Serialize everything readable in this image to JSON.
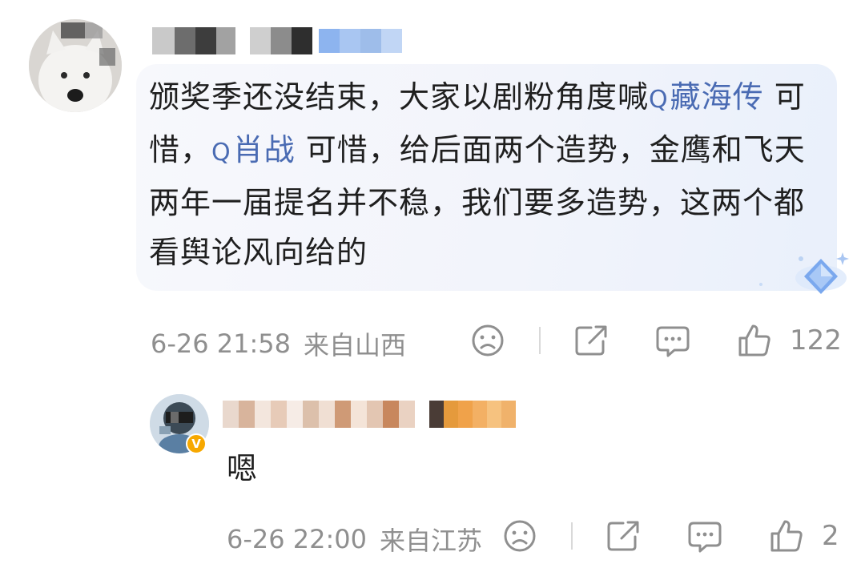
{
  "comment": {
    "text_segments": [
      {
        "kind": "text",
        "value": "颁奖季还没结束，大家以剧粉角度喊"
      },
      {
        "kind": "topic",
        "value": "藏海传"
      },
      {
        "kind": "text",
        "value": " 可惜，"
      },
      {
        "kind": "topic",
        "value": "肖战"
      },
      {
        "kind": "text",
        "value": " 可惜，给后面两个造势，金鹰和飞天两年一届提名并不稳，我们要多造势，这两个都看舆论风向给的"
      }
    ],
    "time": "6-26 21:58",
    "location": "来自山西",
    "like_count": "122",
    "icons": [
      "sad-face-icon",
      "share-icon",
      "comment-icon",
      "thumbs-up-icon"
    ]
  },
  "reply": {
    "text": "嗯",
    "time": "6-26 22:00",
    "location": "来自江苏",
    "like_count": "2",
    "badge_label": "V",
    "icons": [
      "sad-face-icon",
      "share-icon",
      "comment-icon",
      "thumbs-up-icon"
    ]
  },
  "colors": {
    "topic_link": "#4a6bb3",
    "meta_gray": "#8f8f8f",
    "badge_orange": "#f7a800",
    "bubble_bg": "#f2f4fb"
  }
}
